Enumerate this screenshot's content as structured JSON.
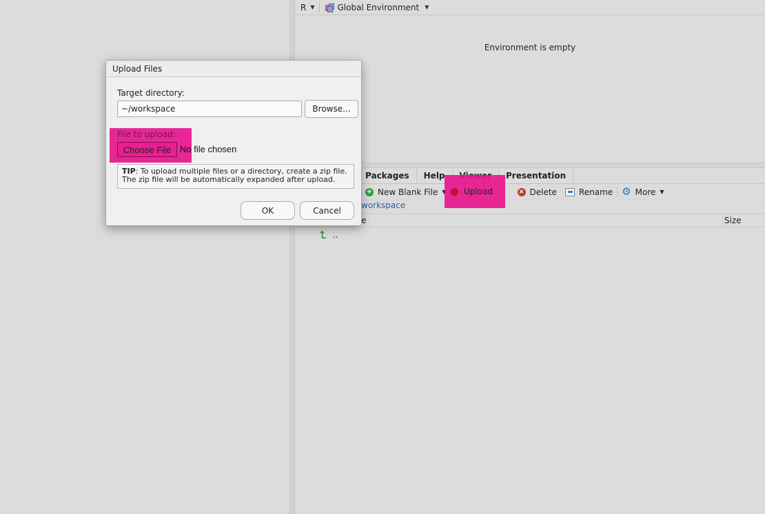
{
  "environment": {
    "language": "R",
    "scope": "Global Environment",
    "empty_message": "Environment is empty"
  },
  "files_pane": {
    "tabs": [
      "Packages",
      "Help",
      "Viewer",
      "Presentation"
    ],
    "toolbar": {
      "new_blank_file": "New Blank File",
      "upload": "Upload",
      "delete": "Delete",
      "rename": "Rename",
      "more": "More"
    },
    "breadcrumb": "workspace",
    "columns": {
      "name": "e",
      "size": "Size"
    },
    "up_row_label": ".."
  },
  "dialog": {
    "title": "Upload Files",
    "target_label": "Target directory:",
    "target_value": "~/workspace",
    "browse_label": "Browse...",
    "file_label": "File to upload:",
    "choose_label": "Choose File",
    "no_file_label": "No file chosen",
    "tip_bold": "TIP",
    "tip_line1": ": To upload multiple files or a directory, create a zip file.",
    "tip_line2": "The zip file will be automatically expanded after upload.",
    "ok_label": "OK",
    "cancel_label": "Cancel"
  },
  "colors": {
    "highlight": "#e6168d",
    "background": "#dcdcdc",
    "link": "#2a5db0"
  }
}
